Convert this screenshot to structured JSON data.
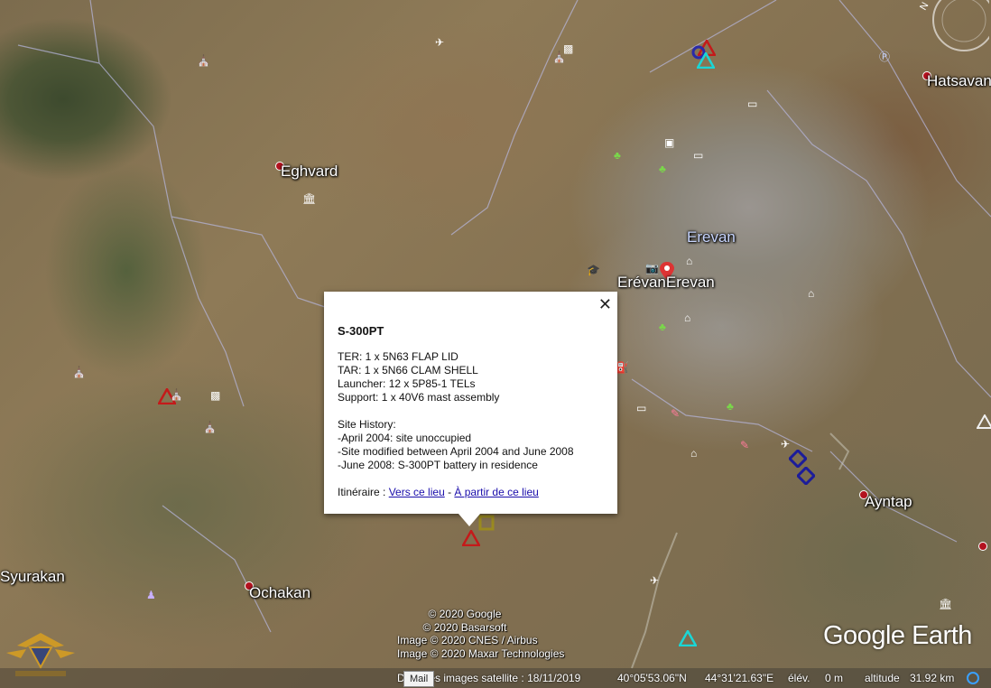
{
  "places": {
    "eghvard": "Eghvard",
    "erevan_top": "Erevan",
    "erevan_main": "ErévanErevan",
    "hatsavan": "Hatsavan",
    "ayntap": "Ayntap",
    "syurakan": "Syurakan",
    "ochakan": "Ochakan"
  },
  "popup": {
    "title": "S-300PT",
    "lines": [
      "TER: 1 x 5N63 FLAP LID",
      "TAR: 1 x 5N66 CLAM SHELL",
      "Launcher: 12 x 5P85-1 TELs",
      "Support: 1 x 40V6 mast assembly"
    ],
    "history_heading": "Site History:",
    "history": [
      "-April 2004: site unoccupied",
      "-Site modified between April 2004 and June 2008",
      "-June 2008: S-300PT battery in residence"
    ],
    "route_label": "Itinéraire : ",
    "route_to": "Vers ce lieu",
    "route_sep": " - ",
    "route_from": "À partir de ce lieu",
    "close_symbol": "✕"
  },
  "attribution": [
    "© 2020 Google",
    "© 2020 Basarsoft",
    "Image © 2020 CNES / Airbus",
    "Image © 2020 Maxar Technologies"
  ],
  "logo": "Google Earth",
  "status": {
    "date": "Date des images satellite : 18/11/2019",
    "lat": "40°05'53.06\"N",
    "lon": "44°31'21.63\"E",
    "elev_label": "élév.",
    "elev_value": "0 m",
    "alt_label": "altitude",
    "alt_value": "31.92 km"
  },
  "tooltip": "Mail",
  "compass": {
    "north": "N"
  },
  "colors": {
    "sam_red": "#c41a1a",
    "sam_cyan": "#1ad6d6",
    "diamond_blue": "#1c1c9a",
    "pin_red": "#b3121f"
  }
}
